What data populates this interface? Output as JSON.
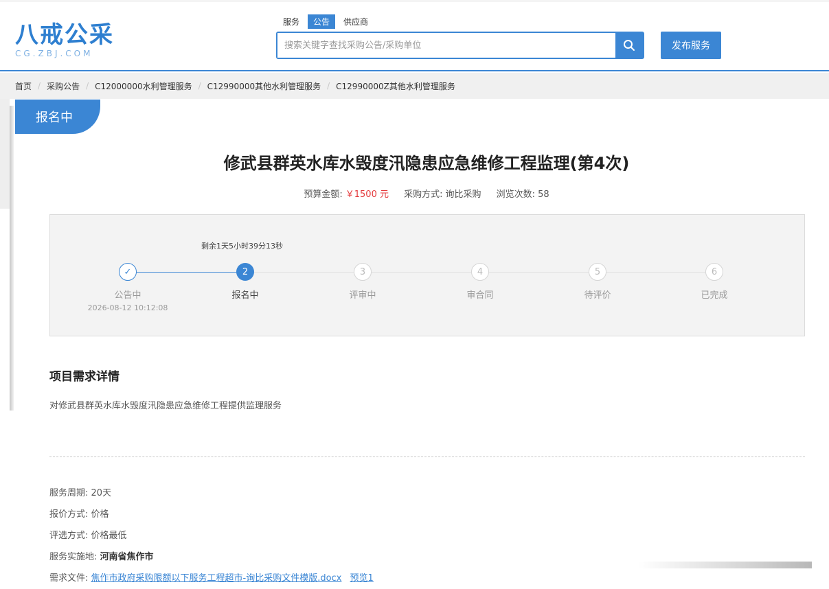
{
  "header": {
    "logo_text": "八戒公采",
    "logo_sub": "CG.ZBJ.COM",
    "tabs": [
      {
        "label": "服务"
      },
      {
        "label": "公告"
      },
      {
        "label": "供应商"
      }
    ],
    "active_tab": "公告",
    "search_placeholder": "搜索关键字查找采购公告/采购单位",
    "publish_label": "发布服务",
    "accent_color": "#3b86d4"
  },
  "breadcrumb": [
    "首页",
    "采购公告",
    "C12000000水利管理服务",
    "C12990000其他水利管理服务",
    "C12990000Z其他水利管理服务"
  ],
  "status_tag": "报名中",
  "project": {
    "title": "修武县群英水库水毁度汛隐患应急维修工程监理(第4次)",
    "budget_label": "预算金额:",
    "budget_value": "￥1500 元",
    "method_label": "采购方式:",
    "method_value": "询比采购",
    "views_label": "浏览次数:",
    "views_value": "58"
  },
  "progress": {
    "countdown": "剩余1天5小时39分13秒",
    "steps": [
      {
        "num": "✓",
        "label": "公告中",
        "date": "2026-08-12 10:12:08",
        "state": "done"
      },
      {
        "num": "2",
        "label": "报名中",
        "date": "",
        "state": "active"
      },
      {
        "num": "3",
        "label": "评审中",
        "date": "",
        "state": "pending"
      },
      {
        "num": "4",
        "label": "审合同",
        "date": "",
        "state": "pending"
      },
      {
        "num": "5",
        "label": "待评价",
        "date": "",
        "state": "pending"
      },
      {
        "num": "6",
        "label": "已完成",
        "date": "",
        "state": "pending"
      }
    ]
  },
  "details": {
    "section_title": "项目需求详情",
    "description": "对修武县群英水库水毁度汛隐患应急维修工程提供监理服务",
    "service_period_label": "服务周期:",
    "service_period": "20天",
    "quote_method_label": "报价方式:",
    "quote_method": "价格",
    "selection_label": "评选方式:",
    "selection": "价格最低",
    "location_label": "服务实施地:",
    "location": "河南省焦作市",
    "file_label": "需求文件:",
    "file_name": "焦作市政府采购限额以下服务工程超市-询比采购文件模版.docx",
    "preview_label": "预览1"
  }
}
